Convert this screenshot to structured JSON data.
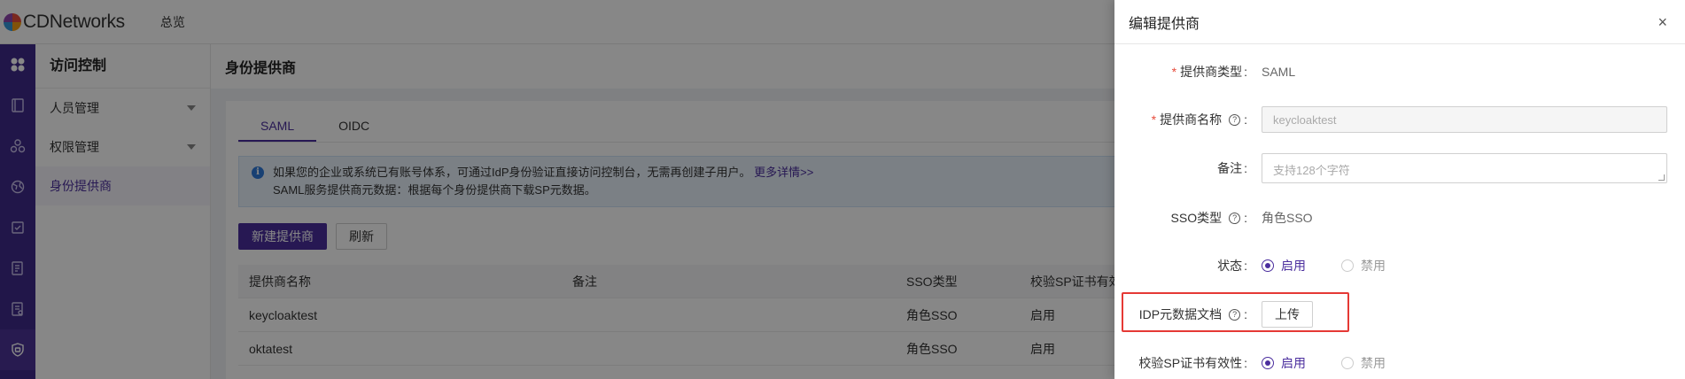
{
  "topbar": {
    "brand": "CDNetworks",
    "nav_overview": "总览"
  },
  "subnav": {
    "title": "访问控制",
    "items": [
      {
        "label": "人员管理"
      },
      {
        "label": "权限管理"
      },
      {
        "label": "身份提供商"
      }
    ]
  },
  "main": {
    "header": "身份提供商",
    "tabs": [
      {
        "label": "SAML"
      },
      {
        "label": "OIDC"
      }
    ],
    "notice": {
      "line1": "如果您的企业或系统已有账号体系，可通过IdP身份验证直接访问控制台，无需再创建子用户。",
      "link": "更多详情>>",
      "line2": "SAML服务提供商元数据：根据每个身份提供商下载SP元数据。"
    },
    "new_button": "新建提供商",
    "refresh_button": "刷新",
    "table": {
      "columns": [
        "提供商名称",
        "备注",
        "SSO类型",
        "校验SP证书有效性"
      ],
      "rows": [
        {
          "name": "keycloaktest",
          "remark": "",
          "sso": "角色SSO",
          "verify": "启用"
        },
        {
          "name": "oktatest",
          "remark": "",
          "sso": "角色SSO",
          "verify": "启用"
        }
      ]
    }
  },
  "drawer": {
    "title": "编辑提供商",
    "close": "×",
    "form": {
      "provider_type_label": "提供商类型",
      "provider_type_value": "SAML",
      "provider_name_label": "提供商名称",
      "provider_name_value": "keycloaktest",
      "remark_label": "备注",
      "remark_placeholder": "支持128个字符",
      "sso_type_label": "SSO类型",
      "sso_type_value": "角色SSO",
      "status_label": "状态",
      "status_on": "启用",
      "status_off": "禁用",
      "idp_label": "IDP元数据文档",
      "upload_button": "上传",
      "verify_label": "校验SP证书有效性",
      "verify_on": "启用",
      "verify_off": "禁用"
    }
  },
  "colors": {
    "brand": "#4b2e9e",
    "rail": "#3f2a8a",
    "highlight": "#e53935",
    "required": "#e74c3c"
  }
}
